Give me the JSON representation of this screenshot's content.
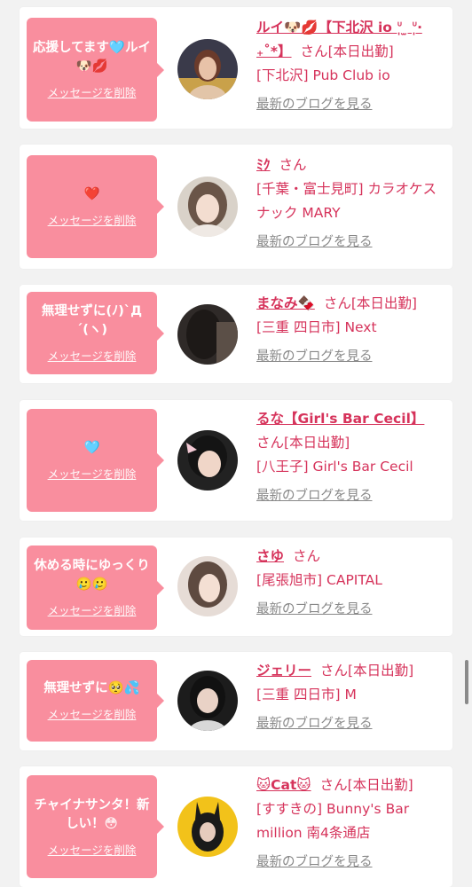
{
  "colors": {
    "accent": "#d6335b",
    "bubble": "#f98e9e",
    "muted": "#888888",
    "background": "#f2f2f2"
  },
  "common": {
    "delete_label": "メッセージを削除",
    "blog_label": "最新のブログを見る",
    "san": "さん"
  },
  "cards": [
    {
      "message": "応援してます🩵ルイ🐶💋",
      "name": "ルイ🐶💋【下北沢 io ᐡ̩ ̫ ᐡ̩‧₊˚*】",
      "status": "[本日出勤]",
      "shop": "[下北沢] Pub Club io"
    },
    {
      "message": "❤️",
      "name": "ﾐｸ",
      "status": "",
      "shop": "[千葉・富士見町] カラオケスナック MARY"
    },
    {
      "message": "無理せずに(ﾉ)`Д´(ヽ)",
      "name": "まなみ🍫",
      "status": "[本日出勤]",
      "shop": "[三重 四日市] Next"
    },
    {
      "message": "🩵",
      "name": "るな【Girl's Bar Cecil】",
      "status": "[本日出勤]",
      "shop": "[八王子] Girl's Bar Cecil"
    },
    {
      "message": "休める時にゆっくり🥲🥲",
      "name": "さゆ",
      "status": "",
      "shop": "[尾張旭市] CAPITAL"
    },
    {
      "message": "無理せずに🥺💦",
      "name": "ジェリー",
      "status": "[本日出勤]",
      "shop": "[三重 四日市] M"
    },
    {
      "message": "チャイナサンタ！新しい！😳",
      "name": "🐱Cat🐱",
      "status": "[本日出勤]",
      "shop": "[すすきの] Bunny's Bar million 南4条通店"
    }
  ]
}
